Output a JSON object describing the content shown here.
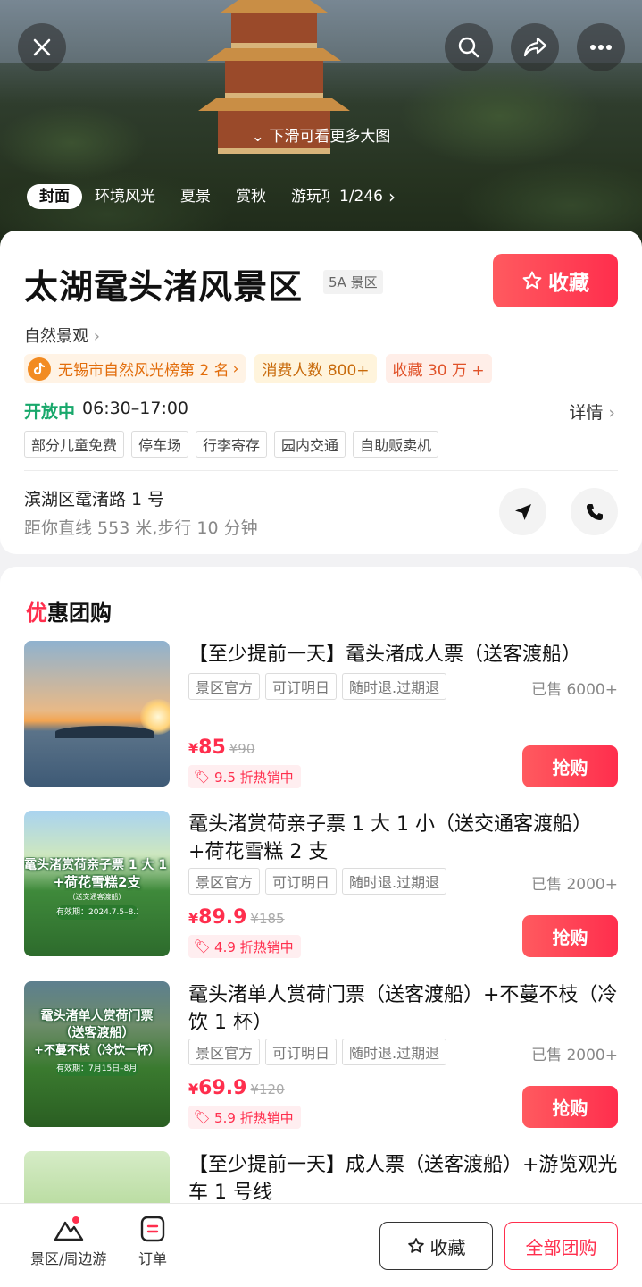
{
  "hero": {
    "close_icon": "close-icon",
    "search_icon": "search-icon",
    "share_icon": "share-icon",
    "more_icon": "more-icon",
    "hint": "下滑可看更多大图",
    "tabs": [
      "封面",
      "环境风光",
      "夏景",
      "赏秋",
      "游玩项"
    ],
    "counter": "1/246"
  },
  "info": {
    "title": "太湖鼋头渚风景区",
    "level": "5A 景区",
    "favorite_label": "收藏",
    "category": "自然景观",
    "rank": "无锡市自然风光榜第 2 名",
    "consumers": "消费人数 800+",
    "favorites": "收藏 30 万 +",
    "open_status": "开放中",
    "hours": "06:30–17:00",
    "detail_label": "详情",
    "facilities": [
      "部分儿童免费",
      "停车场",
      "行李寄存",
      "园内交通",
      "自助贩卖机"
    ],
    "address": "滨湖区鼋渚路 1 号",
    "distance": "距你直线 553 米,步行 10 分钟"
  },
  "deals": {
    "section_title_first": "优",
    "section_title_rest": "惠团购",
    "items": [
      {
        "title": "【至少提前一天】鼋头渚成人票（送客渡船）",
        "tags": [
          "景区官方",
          "可订明日",
          "随时退.过期退"
        ],
        "sold": "已售 6000+",
        "price": "85",
        "original": "¥90",
        "discount": "9.5 折热销中",
        "buy": "抢购"
      },
      {
        "title": "鼋头渚赏荷亲子票 1 大 1 小（送交通客渡船）+荷花雪糕 2 支",
        "tags": [
          "景区官方",
          "可订明日",
          "随时退.过期退"
        ],
        "sold": "已售 2000+",
        "price": "89.9",
        "original": "¥185",
        "discount": "4.9 折热销中",
        "buy": "抢购",
        "thumb_title_1": "鼋头渚赏荷亲子票 1 大 1 小",
        "thumb_title_2": "+荷花雪糕2支",
        "thumb_sub": "（送交通客渡船）",
        "thumb_pill": "有效期：2024.7.5–8.31"
      },
      {
        "title": "鼋头渚单人赏荷门票（送客渡船）+不蔓不枝（冷饮 1 杯）",
        "tags": [
          "景区官方",
          "可订明日",
          "随时退.过期退"
        ],
        "sold": "已售 2000+",
        "price": "69.9",
        "original": "¥120",
        "discount": "5.9 折热销中",
        "buy": "抢购",
        "thumb_title_1": "鼋头渚单人赏荷门票",
        "thumb_title_2": "（送客渡船）",
        "thumb_title_3": "+不蔓不枝（冷饮一杯）",
        "thumb_pill": "有效期：7月15日–8月31日"
      },
      {
        "title": "【至少提前一天】成人票（送客渡船）+游览观光车 1 号线"
      }
    ]
  },
  "bottom": {
    "nav_scenic": "景区/周边游",
    "nav_orders": "订单",
    "fav_label": "收藏",
    "all_deals_label": "全部团购"
  },
  "colors": {
    "accent": "#ff2e4d",
    "open_green": "#18a86b",
    "rank_orange": "#e26d0c"
  }
}
